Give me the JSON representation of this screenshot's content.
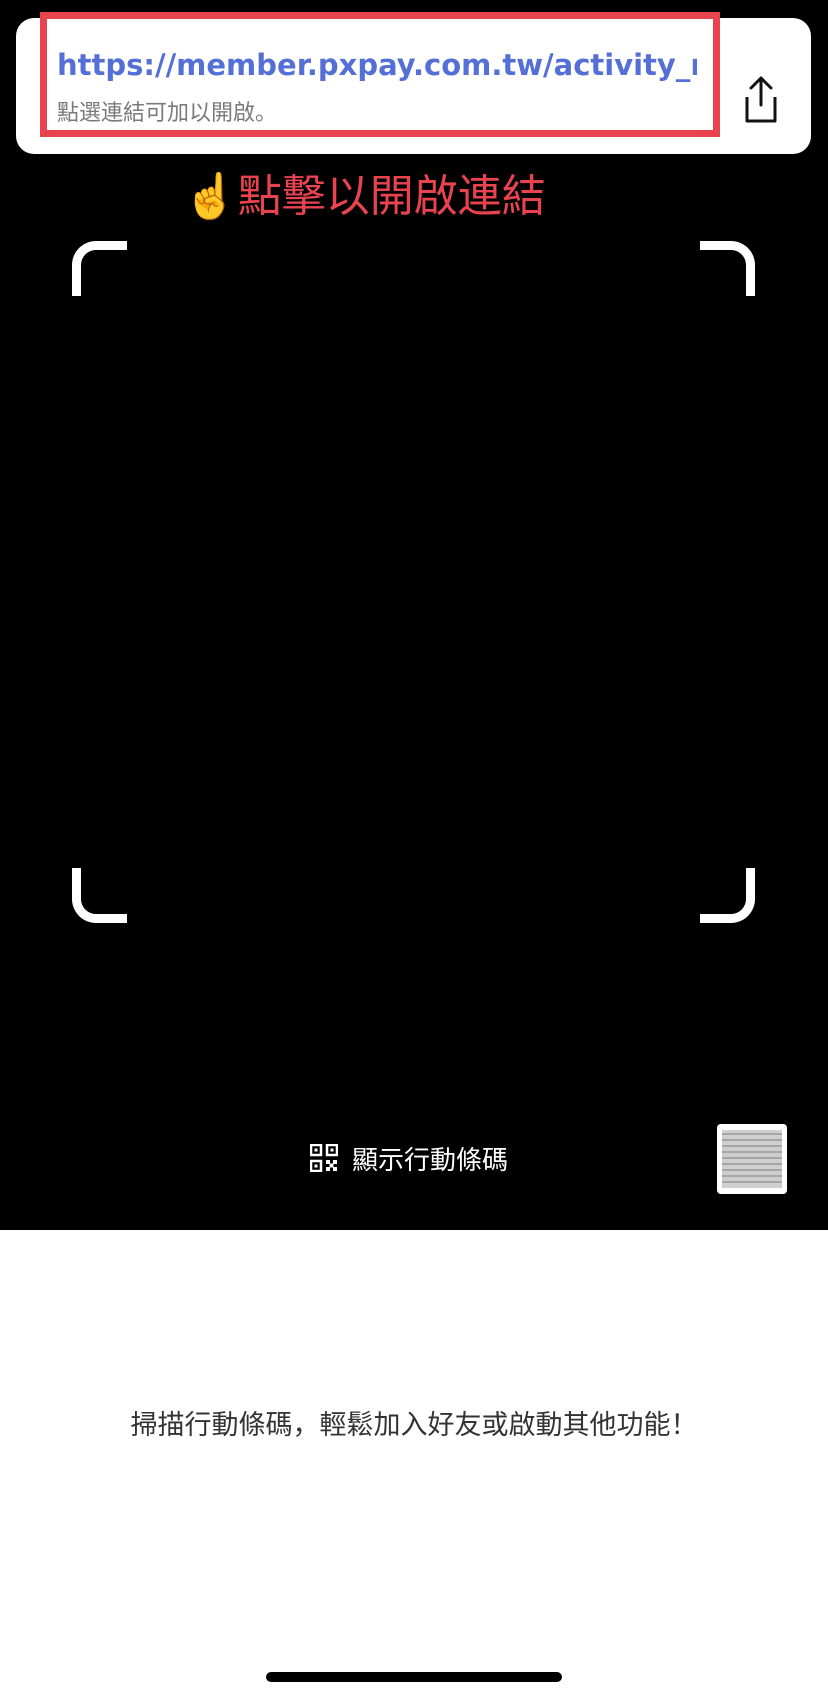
{
  "link_card": {
    "url": "https://member.pxpay.com.tw/activity_red...",
    "hint": "點選連結可加以開啟。",
    "share_icon": "share-icon"
  },
  "instruction": "☝️點擊以開啟連結",
  "camera": {
    "show_code_label": "顯示行動條碼",
    "qr_icon": "qr-code-icon",
    "gallery_icon": "photo-thumbnail"
  },
  "bottom_message": "掃描行動條碼，輕鬆加入好友或啟動其他功能！",
  "colors": {
    "link": "#5470d6",
    "highlight": "#e8434f",
    "instruction": "#e8434f",
    "camera_bg": "#000000"
  }
}
